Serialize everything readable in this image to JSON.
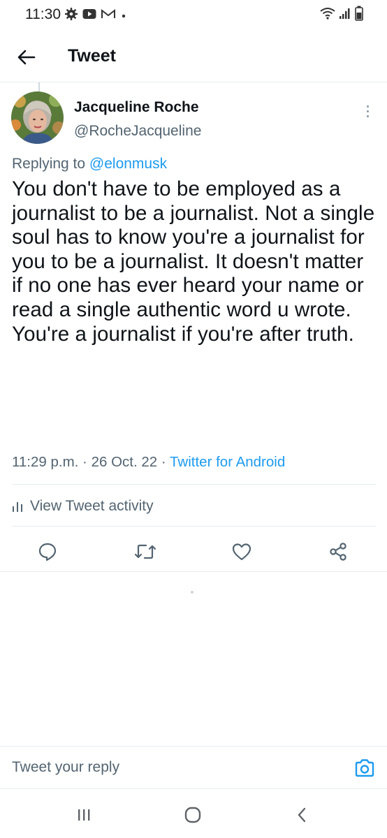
{
  "status_bar": {
    "time": "11:30",
    "left_icons": [
      "settings-icon",
      "youtube-icon",
      "gmail-icon",
      "dot-icon"
    ],
    "right_icons": [
      "wifi-icon",
      "signal-icon",
      "battery-icon"
    ]
  },
  "header": {
    "back_icon": "arrow-left-icon",
    "title": "Tweet"
  },
  "tweet": {
    "author_name": "Jacqueline Roche",
    "author_handle": "@RocheJacqueline",
    "replying_prefix": "Replying to",
    "replying_to": "@elonmusk",
    "text": "You don't have to be employed as a journalist to be a journalist. Not a single soul has to know you're a journalist for you to be a journalist. It doesn't matter if no one has ever heard your name or read a single authentic word u wrote. You're a journalist if you're after truth.",
    "time": "11:29 p.m.",
    "separator": "·",
    "date": "26 Oct. 22",
    "source": "Twitter for Android"
  },
  "activity": {
    "label": "View Tweet activity",
    "icon": "bar-chart-icon"
  },
  "actions": [
    {
      "name": "reply-button",
      "icon": "comment-icon"
    },
    {
      "name": "retweet-button",
      "icon": "retweet-icon"
    },
    {
      "name": "like-button",
      "icon": "heart-icon"
    },
    {
      "name": "share-button",
      "icon": "share-icon"
    }
  ],
  "reply_bar": {
    "placeholder": "Tweet your reply",
    "camera_icon": "camera-icon"
  },
  "nav_bar": {
    "icons": [
      "recent-apps-icon",
      "home-icon",
      "back-icon"
    ]
  },
  "colors": {
    "accent": "#1d9bf0",
    "text_primary": "#0f1419",
    "text_secondary": "#536471",
    "divider": "#e6ecf0",
    "icon_gray": "#536471"
  }
}
